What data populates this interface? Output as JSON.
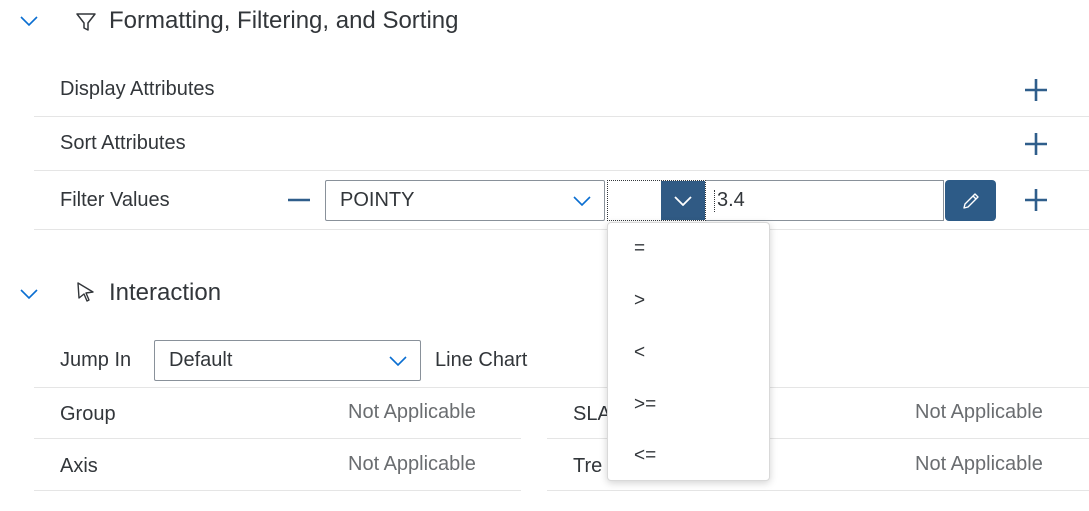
{
  "formatting_section": {
    "title": "Formatting, Filtering, and Sorting",
    "icon": "filter-icon",
    "rows": [
      {
        "label": "Display Attributes"
      },
      {
        "label": "Sort Attributes"
      },
      {
        "label": "Filter Values"
      }
    ],
    "filter": {
      "attribute": "POINTY",
      "operator": "",
      "value": "3.4"
    },
    "operator_options": [
      "=",
      ">",
      "<",
      ">=",
      "<="
    ]
  },
  "interaction_section": {
    "title": "Interaction",
    "icon": "cursor-icon",
    "jump_in_label": "Jump In",
    "jump_in_value": "Default",
    "jump_in_suffix": "Line Chart",
    "left_rows": [
      {
        "label": "Group",
        "value": "Not Applicable"
      },
      {
        "label": "Axis",
        "value": "Not Applicable"
      }
    ],
    "right_rows": [
      {
        "label": "SLA",
        "value": "Not Applicable"
      },
      {
        "label": "Tre",
        "value": "Not Applicable"
      }
    ]
  },
  "colors": {
    "accent": "#0a6ed1",
    "icon_blue": "#2f5e8b",
    "button_dark": "#2d5b87",
    "text": "#32363a",
    "muted": "#6a6d70"
  }
}
